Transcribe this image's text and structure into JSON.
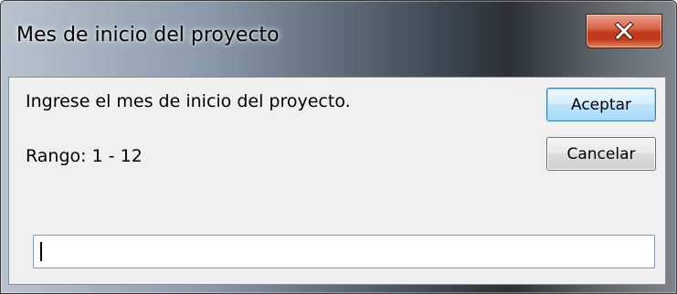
{
  "window": {
    "title": "Mes de inicio del proyecto"
  },
  "titlebar": {
    "close_icon": "close-x-icon"
  },
  "dialog": {
    "prompt": "Ingrese el mes de inicio del proyecto.",
    "range": "Rango: 1 - 12",
    "input_value": ""
  },
  "buttons": {
    "accept_label": "Aceptar",
    "cancel_label": "Cancelar"
  },
  "colors": {
    "close_button": "#c7472a",
    "dialog_background": "#f0f0f0",
    "default_button_border": "#3c7fb1"
  }
}
